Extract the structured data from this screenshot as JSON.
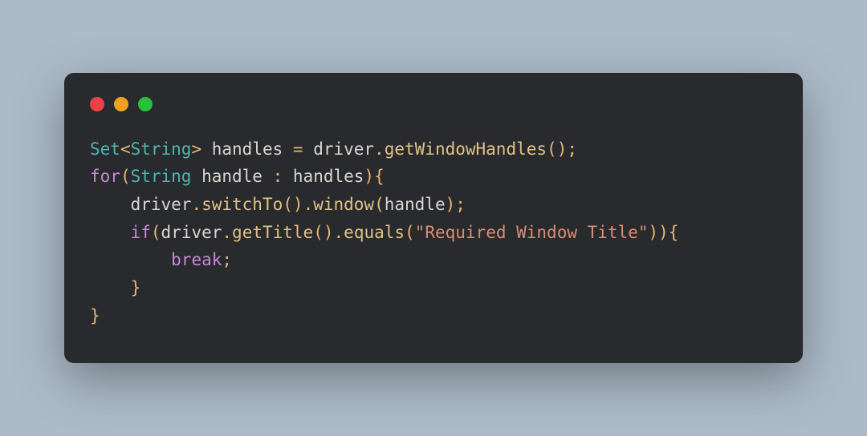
{
  "window": {
    "colors": {
      "red": "#ed4245",
      "yellow": "#f0a020",
      "green": "#26c23a"
    }
  },
  "code": {
    "line1": {
      "set": "Set",
      "lt": "<",
      "string": "String",
      "gt": ">",
      "handles": " handles ",
      "eq": "=",
      "driver": " driver",
      "dot1": ".",
      "getWinHandles": "getWindowHandles",
      "lparen": "(",
      "rparen": ")",
      "semi": ";"
    },
    "line2": {
      "for": "for",
      "lparen": "(",
      "string": "String",
      "handle": " handle ",
      "colon": ":",
      "handles": " handles",
      "rparen": ")",
      "lbrace": "{"
    },
    "line3": {
      "indent": "    ",
      "driver": "driver",
      "dot1": ".",
      "switchTo": "switchTo",
      "lparen1": "(",
      "rparen1": ")",
      "dot2": ".",
      "window": "window",
      "lparen2": "(",
      "handle": "handle",
      "rparen2": ")",
      "semi": ";"
    },
    "line4": {
      "indent": "    ",
      "if": "if",
      "lparen1": "(",
      "driver": "driver",
      "dot1": ".",
      "getTitle": "getTitle",
      "lparen2": "(",
      "rparen2": ")",
      "dot2": ".",
      "equals": "equals",
      "lparen3": "(",
      "str": "\"Required Window Title\"",
      "rparen3": ")",
      "rparen1": ")",
      "lbrace": "{"
    },
    "line5": {
      "indent": "        ",
      "break": "break",
      "semi": ";"
    },
    "line6": {
      "indent": "    ",
      "rbrace": "}"
    },
    "line7": {
      "rbrace": "}"
    }
  }
}
